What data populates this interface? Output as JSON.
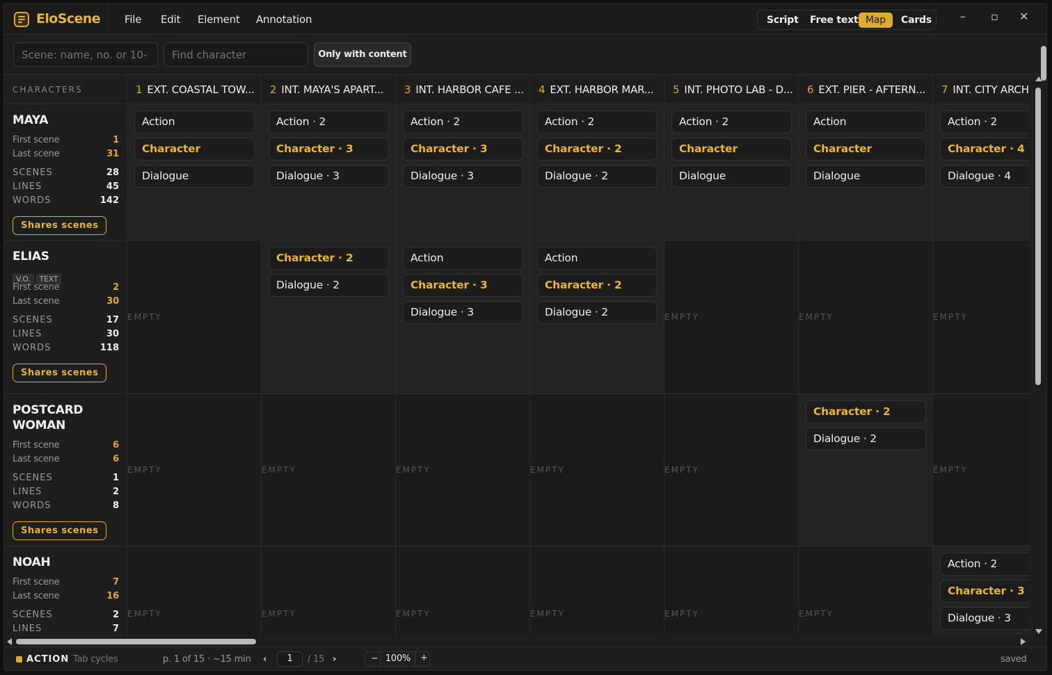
{
  "app": {
    "name": "EloScene"
  },
  "menu": [
    "File",
    "Edit",
    "Element",
    "Annotation"
  ],
  "views": {
    "items": [
      "Script",
      "Free text",
      "Map",
      "Cards"
    ],
    "active": "Map"
  },
  "window_controls": {
    "minimize": "–",
    "maximize": "▫",
    "close": "✕"
  },
  "toolbar": {
    "scene_search_placeholder": "Scene: name, no. or 10-",
    "char_search_placeholder": "Find character",
    "only_with_content": "Only with content"
  },
  "grid": {
    "characters_header": "CHARACTERS",
    "empty_label": "EMPTY",
    "shares_label": "Shares scenes",
    "stat_labels": {
      "first": "First scene",
      "last": "Last scene",
      "scenes": "SCENES",
      "lines": "LINES",
      "words": "WORDS"
    },
    "scenes": [
      {
        "num": "1",
        "name": "EXT. COASTAL TOW..."
      },
      {
        "num": "2",
        "name": "INT. MAYA'S APART..."
      },
      {
        "num": "3",
        "name": "INT. HARBOR CAFE ..."
      },
      {
        "num": "4",
        "name": "EXT. HARBOR MAR..."
      },
      {
        "num": "5",
        "name": "INT. PHOTO LAB - D..."
      },
      {
        "num": "6",
        "name": "EXT. PIER - AFTERN..."
      },
      {
        "num": "7",
        "name": "INT. CITY ARCH"
      }
    ],
    "characters": [
      {
        "name": "MAYA",
        "tags": [],
        "first": "1",
        "last": "31",
        "scenes": "28",
        "lines": "45",
        "words": "142",
        "cells": [
          [
            {
              "t": "Action"
            },
            {
              "t": "Character",
              "g": true
            },
            {
              "t": "Dialogue"
            }
          ],
          [
            {
              "t": "Action · 2"
            },
            {
              "t": "Character · 3",
              "g": true
            },
            {
              "t": "Dialogue · 3"
            }
          ],
          [
            {
              "t": "Action · 2"
            },
            {
              "t": "Character · 3",
              "g": true
            },
            {
              "t": "Dialogue · 3"
            }
          ],
          [
            {
              "t": "Action · 2"
            },
            {
              "t": "Character · 2",
              "g": true
            },
            {
              "t": "Dialogue · 2"
            }
          ],
          [
            {
              "t": "Action · 2"
            },
            {
              "t": "Character",
              "g": true
            },
            {
              "t": "Dialogue"
            }
          ],
          [
            {
              "t": "Action"
            },
            {
              "t": "Character",
              "g": true
            },
            {
              "t": "Dialogue"
            }
          ],
          [
            {
              "t": "Action · 2"
            },
            {
              "t": "Character · 4",
              "g": true
            },
            {
              "t": "Dialogue · 4"
            }
          ]
        ]
      },
      {
        "name": "ELIAS",
        "tags": [
          "V.O.",
          "TEXT"
        ],
        "first": "2",
        "last": "30",
        "scenes": "17",
        "lines": "30",
        "words": "118",
        "cells": [
          [],
          [
            {
              "t": "Character · 2",
              "g": true
            },
            {
              "t": "Dialogue · 2"
            }
          ],
          [
            {
              "t": "Action"
            },
            {
              "t": "Character · 3",
              "g": true
            },
            {
              "t": "Dialogue · 3"
            }
          ],
          [
            {
              "t": "Action"
            },
            {
              "t": "Character · 2",
              "g": true
            },
            {
              "t": "Dialogue · 2"
            }
          ],
          [],
          [],
          []
        ]
      },
      {
        "name": "POSTCARD WOMAN",
        "tags": [],
        "first": "6",
        "last": "6",
        "scenes": "1",
        "lines": "2",
        "words": "8",
        "cells": [
          [],
          [],
          [],
          [],
          [],
          [
            {
              "t": "Character · 2",
              "g": true
            },
            {
              "t": "Dialogue · 2"
            }
          ],
          []
        ]
      },
      {
        "name": "NOAH",
        "tags": [],
        "first": "7",
        "last": "16",
        "scenes": "2",
        "lines": "7",
        "words": "",
        "cells": [
          [],
          [],
          [],
          [],
          [],
          [],
          [
            {
              "t": "Action · 2"
            },
            {
              "t": "Character · 3",
              "g": true
            },
            {
              "t": "Dialogue · 3"
            }
          ]
        ]
      }
    ]
  },
  "status": {
    "mode": "ACTION",
    "hint": "Tab cycles",
    "page_info": "p. 1 of 15 · ~15 min",
    "page_value": "1",
    "page_total": "/ 15",
    "zoom": "100%",
    "saved": "saved"
  },
  "colors": {
    "accent": "#e0a930",
    "background": "#1e1e1e",
    "empty_cell": "#1b1b1b",
    "filled_cell": "#232323"
  }
}
